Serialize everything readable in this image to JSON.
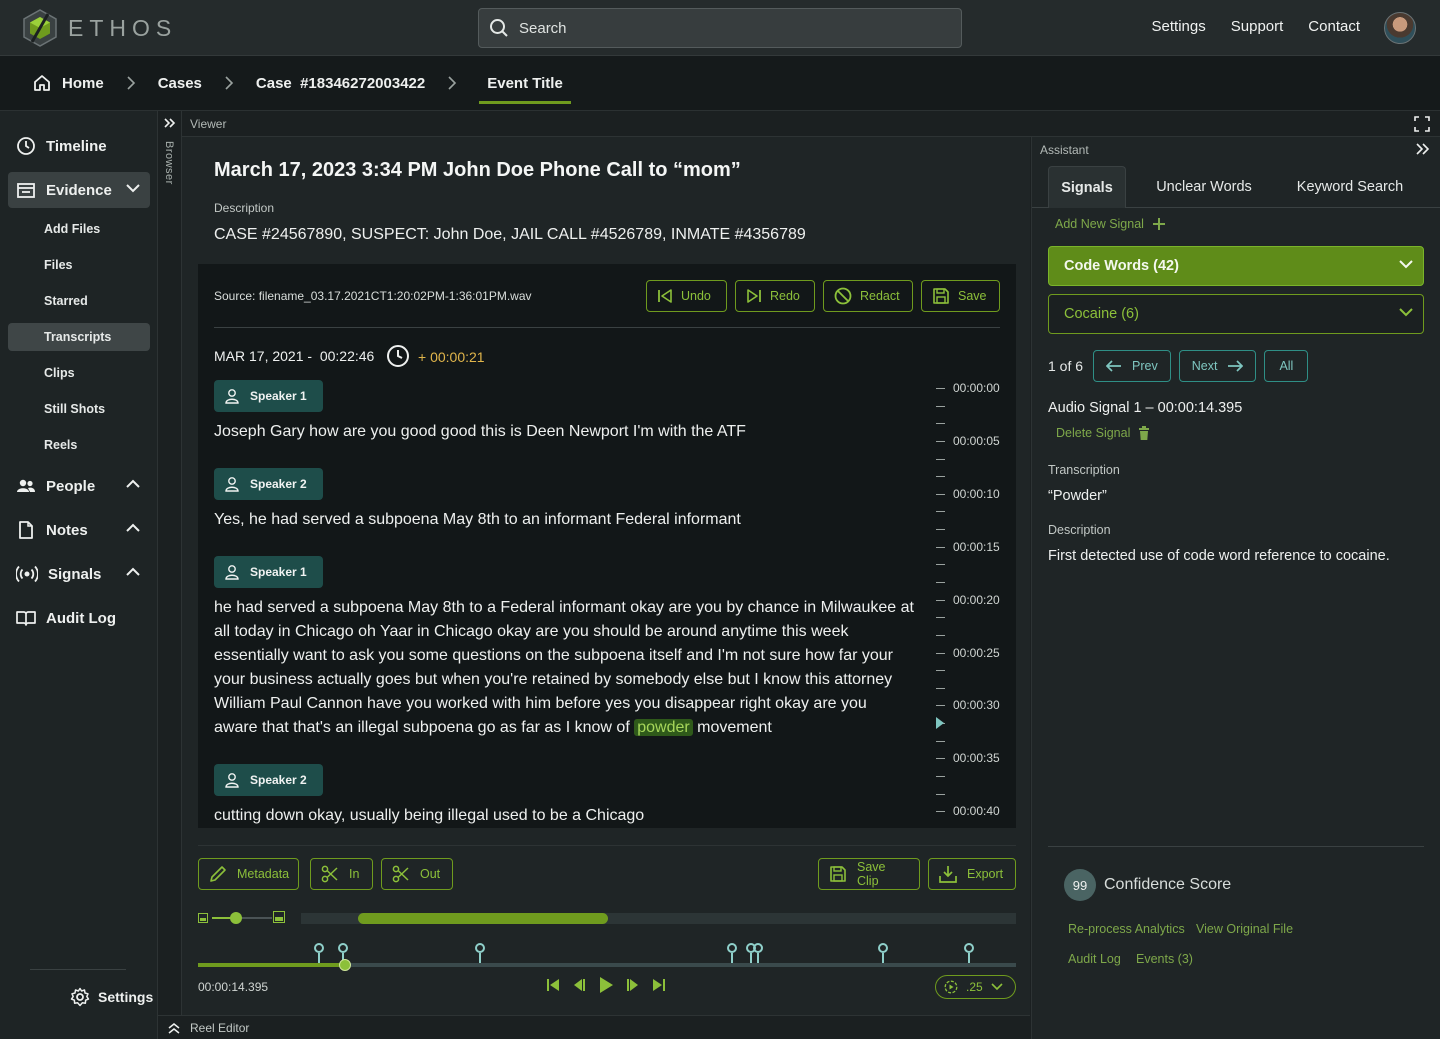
{
  "app": {
    "logo_text": "ETHOS",
    "search_placeholder": "Search",
    "nav": [
      "Settings",
      "Support",
      "Contact"
    ]
  },
  "breadcrumb": [
    "Home",
    "Cases",
    "Case  #18346272003422",
    "Event Title"
  ],
  "sidebar": {
    "items": {
      "timeline": "Timeline",
      "evidence": "Evidence",
      "people": "People",
      "notes": "Notes",
      "signals": "Signals",
      "audit_log": "Audit Log"
    },
    "evidence_sub": [
      "Add Files",
      "Files",
      "Starred",
      "Transcripts",
      "Clips",
      "Still Shots",
      "Reels"
    ],
    "active_sub": "Transcripts",
    "settings": "Settings"
  },
  "rail": {
    "label": "Browser"
  },
  "viewer": {
    "label": "Viewer",
    "title": "March 17, 2023 3:34 PM John Doe Phone Call to “mom”",
    "description_label": "Description",
    "description": "CASE #24567890, SUSPECT: John Doe, JAIL CALL #4526789, INMATE #4356789",
    "source": "Source: filename_03.17.2021CT1:20:02PM-1:36:01PM.wav",
    "toolbar": {
      "undo": "Undo",
      "redo": "Redo",
      "redact": "Redact",
      "save": "Save"
    },
    "timestamp": "MAR 17, 2021 -  00:22:46",
    "offset": "+ 00:00:21",
    "utterances": [
      {
        "speaker": "Speaker 1",
        "text": "Joseph Gary how are you good good this is Deen Newport I'm with the ATF"
      },
      {
        "speaker": "Speaker 2",
        "text": "Yes, he had served a subpoena May 8th to an informant Federal informant"
      },
      {
        "speaker": "Speaker 1",
        "text_before": "he had served a subpoena May 8th to a Federal informant okay are you by chance in Milwaukee at all today in Chicago oh Yaar in Chicago okay are you should be around anytime this week essentially want to ask you some questions on the subpoena itself and I'm not sure how far your your business actually goes but when you're retained by somebody else but I know this attorney William Paul Cannon have you worked with him before yes you disappear right okay are you aware that that's an illegal subpoena go as far as I know of",
        "highlight": "powder",
        "text_after": "movement"
      },
      {
        "speaker": "Speaker 2",
        "text": "cutting down okay, usually being illegal used to be a Chicago"
      }
    ],
    "ruler_labels": [
      "00:00:00",
      "00:00:05",
      "00:00:10",
      "00:00:15",
      "00:00:20",
      "00:00:25",
      "00:00:30",
      "00:00:35",
      "00:00:40"
    ],
    "bottom_buttons": {
      "metadata": "Metadata",
      "in": "In",
      "out": "Out",
      "save_clip": "Save Clip",
      "export": "Export"
    },
    "current_time": "00:00:14.395",
    "speed": ".25",
    "playback_progress": 0.18,
    "zoom_window": [
      0.08,
      0.43
    ],
    "marker_positions": [
      0.148,
      0.177,
      0.345,
      0.653,
      0.676,
      0.685,
      0.838,
      0.943
    ]
  },
  "reel_editor": {
    "label": "Reel Editor"
  },
  "assistant": {
    "label": "Assistant",
    "tabs": [
      "Signals",
      "Unclear Words",
      "Keyword Search"
    ],
    "active_tab": "Signals",
    "add_signal": "Add New Signal",
    "groups": [
      {
        "label": "Code Words (42)",
        "open": true
      },
      {
        "label": "Cocaine (6)",
        "open": false
      }
    ],
    "pager": {
      "count": "1 of 6",
      "prev": "Prev",
      "next": "Next",
      "all": "All"
    },
    "signal_title": "Audio Signal 1 – 00:00:14.395",
    "delete_signal": "Delete Signal",
    "transcription_label": "Transcription",
    "transcription": "“Powder”",
    "description_label": "Description",
    "description": "First detected use of code word reference to cocaine.",
    "confidence_score": "99",
    "confidence_label": "Confidence Score",
    "links": [
      "Re-process Analytics",
      "View Original File",
      "Audit Log",
      "Events (3)"
    ]
  },
  "colors": {
    "accent_green": "#6f9b1e",
    "accent_teal": "#2f8f86",
    "highlight": "#e0b54b"
  }
}
